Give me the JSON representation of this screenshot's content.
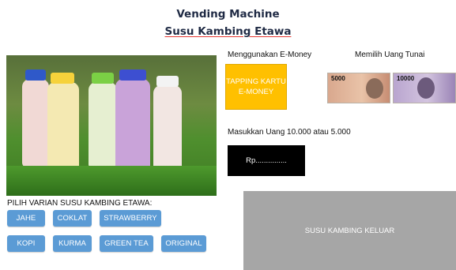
{
  "title": {
    "line1": "Vending Machine",
    "line2": "Susu Kambing Etawa"
  },
  "payment": {
    "emoney_label": "Menggunakan E-Money",
    "cash_label": "Memilih Uang Tunai",
    "tap_button": "TAPPING KARTU E-MONEY",
    "notes": [
      {
        "value": "5000",
        "color": "#cfa28a"
      },
      {
        "value": "10000",
        "color": "#a58fbf"
      }
    ]
  },
  "insert": {
    "instruction": "Masukkan Uang 10.000 atau 5.000",
    "display": "Rp..............."
  },
  "variants": {
    "heading": "PILIH VARIAN SUSU KAMBING ETAWA:",
    "items": [
      "JAHE",
      "COKLAT",
      "STRAWBERRY",
      "KOPI",
      "KURMA",
      "GREEN TEA",
      "ORIGINAL"
    ]
  },
  "output": {
    "label": "SUSU KAMBING KELUAR"
  },
  "colors": {
    "button": "#5b9bd5",
    "tap": "#ffc000",
    "output": "#a6a6a6"
  }
}
